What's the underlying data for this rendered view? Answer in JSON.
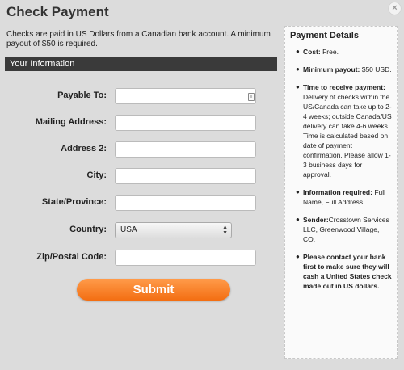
{
  "modal": {
    "title": "Check Payment",
    "close": "×"
  },
  "intro": "Checks are paid in US Dollars from a Canadian bank account. A minimum payout of $50 is required.",
  "section": {
    "title": "Your Information"
  },
  "form": {
    "payable_to": {
      "label": "Payable To:",
      "value": ""
    },
    "mailing_address": {
      "label": "Mailing Address:",
      "value": ""
    },
    "address2": {
      "label": "Address 2:",
      "value": ""
    },
    "city": {
      "label": "City:",
      "value": ""
    },
    "state": {
      "label": "State/Province:",
      "value": ""
    },
    "country": {
      "label": "Country:",
      "value": "USA"
    },
    "zip": {
      "label": "Zip/Postal Code:",
      "value": ""
    },
    "submit_label": "Submit"
  },
  "details": {
    "title": "Payment Details",
    "items": [
      {
        "key": "Cost:",
        "text": " Free."
      },
      {
        "key": "Minimum payout:",
        "text": " $50 USD."
      },
      {
        "key": "Time to receive payment:",
        "text": " Delivery of checks within the US/Canada can take up to 2-4 weeks; outside Canada/US delivery can take 4-6 weeks. Time is calculated based on date of payment confirmation. Please allow 1-3 business days for approval."
      },
      {
        "key": "Information required:",
        "text": " Full Name, Full Address."
      },
      {
        "key": "Sender:",
        "text": "Crosstown Services LLC, Greenwood Village, CO."
      },
      {
        "key": "Please contact your bank first to make sure they will cash a United States check made out in US dollars.",
        "text": ""
      }
    ]
  },
  "colors": {
    "submit": "#f36e12",
    "section_bar": "#3a3a3a",
    "background": "#dcdcdc"
  }
}
